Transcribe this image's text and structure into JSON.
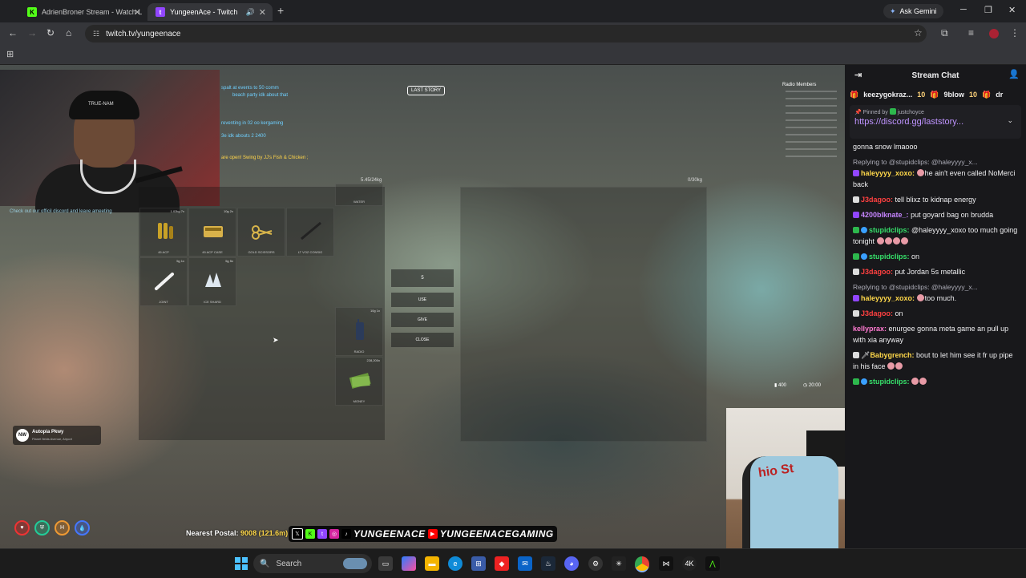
{
  "browser": {
    "tabs": [
      {
        "title": "AdrienBroner Stream - Watch L",
        "icon": "kick-icon",
        "active": false
      },
      {
        "title": "YungeenAce - Twitch",
        "icon": "twitch-icon",
        "active": true
      }
    ],
    "gemini_label": "Ask Gemini",
    "url": "twitch.tv/yungeenace"
  },
  "stream": {
    "cap_text": "TRUE-NAM",
    "feed": [
      "spalt at events to 50 comm",
      "beach party idk about that",
      "reventing in 02 oo kergaming",
      "3e idk abouts 2 2400",
      "are open! Swing by JJ's Fish & Chicken ;",
      "Check out our officil discord and leave ameeting"
    ],
    "radio_title": "Radio Members",
    "logo": "LAST STORY",
    "player_weight": "5.45/24kg",
    "ground_weight": "0/30kg",
    "inventory_slots": [
      {
        "label": "45 ACP",
        "amount": "1.02kg 7x",
        "icon": "ammo-icon"
      },
      {
        "label": "45 ACP CASE",
        "amount": "10g 2x",
        "icon": "ammo-case-icon"
      },
      {
        "label": "GOLD SCISSORS",
        "amount": "",
        "icon": "scissors-icon"
      },
      {
        "label": "LT VOZ CONSIG",
        "amount": "",
        "icon": "blade-icon"
      },
      {
        "label": "JOINT",
        "amount": "5g 1x",
        "icon": "joint-icon"
      },
      {
        "label": "ICE SHARD",
        "amount": "5g 5x",
        "icon": "crystal-icon"
      },
      {
        "label": "RADIO",
        "amount": "10g 1x",
        "icon": "radio-icon"
      },
      {
        "label": "MONEY",
        "amount": "228,200x",
        "icon": "money-icon"
      },
      {
        "label": "WATER",
        "amount": "",
        "icon": "water-icon"
      }
    ],
    "action_buttons": [
      "5",
      "USE",
      "GIVE",
      "CLOSE"
    ],
    "hud_ammo": "400",
    "hud_time": "20:00",
    "location": {
      "badge": "NW",
      "street": "Autopia Pkwy",
      "area": "Planet fields Avenue, Airport"
    },
    "status_icons": [
      "heart-icon",
      "shield-icon",
      "hunger-icon",
      "water-icon"
    ],
    "postal_label": "Nearest Postal:",
    "postal_value": "9008 (121.6m)",
    "socials": [
      "x-icon",
      "kick-icon",
      "twitch-icon",
      "instagram-icon",
      "tiktok-icon"
    ],
    "handle_1": "YUNGEENACE",
    "handle_2": "YUNGEENACEGAMING",
    "cam2_shirt": "hio St"
  },
  "chat": {
    "title": "Stream Chat",
    "leaders": [
      {
        "name": "keezygokraz...",
        "count": "10"
      },
      {
        "name": "9blow",
        "count": "10"
      },
      {
        "name": "dr",
        "count": ""
      }
    ],
    "pinned_by_label": "Pinned by",
    "pinned_by": "justchoyce",
    "pinned_link": "https://discord.gg/laststory...",
    "messages": [
      {
        "reply": "",
        "user": "",
        "text": "gonna snow lmaooo",
        "color": "#efeff1"
      },
      {
        "reply": "Replying to @stupidclips: @haleyyyy_x...",
        "user": "haleyyyy_xoxo:",
        "text": "he ain't even called NoMerci back",
        "color": "#ffd84a"
      },
      {
        "reply": "",
        "user": "J3dagoo:",
        "text": "tell blixz to kidnap energy",
        "color": "#ff4040"
      },
      {
        "reply": "",
        "user": "4200blknate_:",
        "text": "put goyard bag on brudda",
        "color": "#c685ff"
      },
      {
        "reply": "",
        "user": "stupidclips:",
        "text": "@haleyyyy_xoxo too much going tonight",
        "color": "#36e06a"
      },
      {
        "reply": "",
        "user": "stupidclips:",
        "text": "on",
        "color": "#36e06a"
      },
      {
        "reply": "",
        "user": "J3dagoo:",
        "text": "put Jordan 5s metallic",
        "color": "#ff4040"
      },
      {
        "reply": "Replying to @stupidclips: @haleyyyy_x...",
        "user": "haleyyyy_xoxo:",
        "text": "too much.",
        "color": "#ffd84a"
      },
      {
        "reply": "",
        "user": "J3dagoo:",
        "text": "on",
        "color": "#ff4040"
      },
      {
        "reply": "",
        "user": "kellyprax:",
        "text": "enurgee gonna meta game an pull up with xia anyway",
        "color": "#ff7ad1"
      },
      {
        "reply": "",
        "user": "Babygrench:",
        "text": "bout to let him see it fr up pipe in his face",
        "color": "#ffd84a"
      },
      {
        "reply": "",
        "user": "stupidclips:",
        "text": "",
        "color": "#36e06a"
      }
    ]
  },
  "taskbar": {
    "search_placeholder": "Search",
    "apps": [
      "windows-icon",
      "task-view-icon",
      "copilot-icon",
      "file-explorer-icon",
      "edge-icon",
      "store-icon",
      "app-icon",
      "mail-icon",
      "steam-icon",
      "discord-icon",
      "settings-icon",
      "app-icon",
      "chrome-icon",
      "app-icon",
      "app-icon",
      "app-icon"
    ]
  }
}
